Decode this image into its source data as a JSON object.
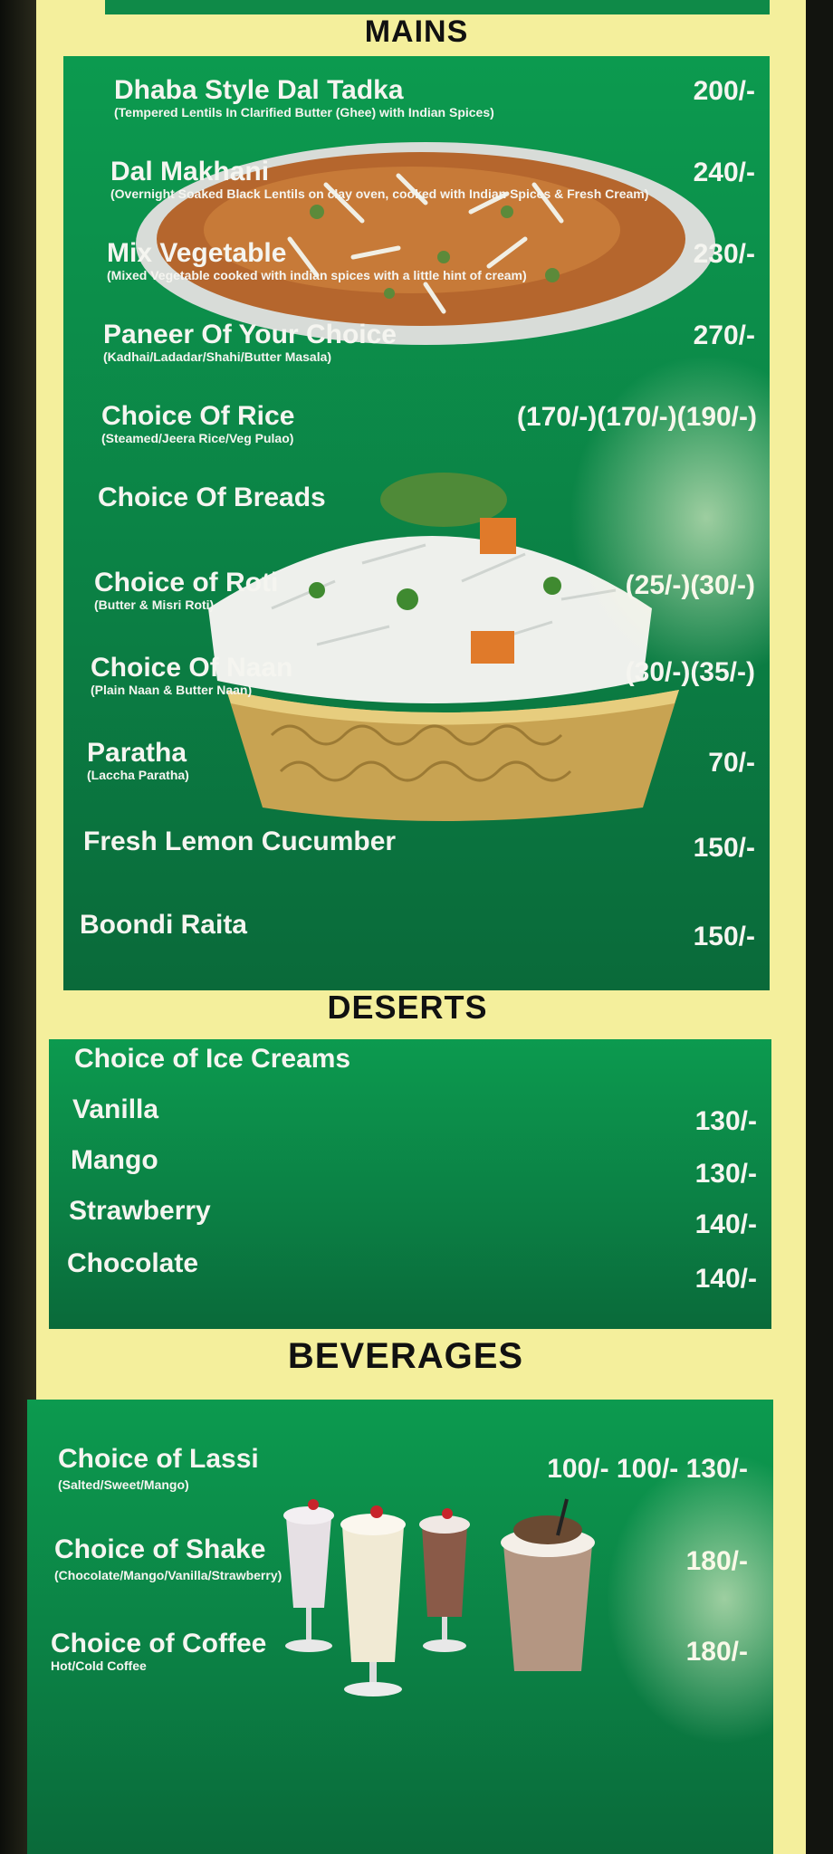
{
  "sections": {
    "mains": {
      "title": "MAINS",
      "items": [
        {
          "name": "Dhaba Style Dal Tadka",
          "desc": "(Tempered Lentils In Clarified Butter (Ghee) with Indian Spices)",
          "price": "200/-"
        },
        {
          "name": "Dal Makhani",
          "desc": "(Overnight Soaked Black Lentils on clay oven, cooked with Indian Spices & Fresh Cream)",
          "price": "240/-"
        },
        {
          "name": "Mix Vegetable",
          "desc": "(Mixed Vegetable cooked with indian spices with a little hint of cream)",
          "price": "230/-"
        },
        {
          "name": "Paneer Of Your Choice",
          "desc": "(Kadhai/Ladadar/Shahi/Butter Masala)",
          "price": "270/-"
        },
        {
          "name": "Choice Of Rice",
          "desc": "(Steamed/Jeera Rice/Veg Pulao)",
          "price": "(170/-)(170/-)(190/-)"
        },
        {
          "name": "Choice Of Breads",
          "desc": "",
          "price": ""
        },
        {
          "name": "Choice of Roti",
          "desc": "(Butter & Misri Roti)",
          "price": "(25/-)(30/-)"
        },
        {
          "name": "Choice Of Naan",
          "desc": "(Plain Naan & Butter Naan)",
          "price": "(30/-)(35/-)"
        },
        {
          "name": "Paratha",
          "desc": "(Laccha Paratha)",
          "price": "70/-"
        },
        {
          "name": "Fresh Lemon Cucumber",
          "desc": "",
          "price": "150/-"
        },
        {
          "name": "Boondi Raita",
          "desc": "",
          "price": "150/-"
        }
      ]
    },
    "deserts": {
      "title": "DESERTS",
      "header": "Choice of Ice Creams",
      "items": [
        {
          "name": "Vanilla",
          "price": "130/-"
        },
        {
          "name": "Mango",
          "price": "130/-"
        },
        {
          "name": "Strawberry",
          "price": "140/-"
        },
        {
          "name": "Chocolate",
          "price": "140/-"
        }
      ]
    },
    "beverages": {
      "title": "BEVERAGES",
      "items": [
        {
          "name": "Choice of Lassi",
          "desc": "(Salted/Sweet/Mango)",
          "price": "100/- 100/- 130/-"
        },
        {
          "name": "Choice of Shake",
          "desc": "(Chocolate/Mango/Vanilla/Strawberry)",
          "price": "180/-"
        },
        {
          "name": "Choice of Coffee",
          "desc": "Hot/Cold Coffee",
          "price": "180/-"
        }
      ]
    }
  },
  "colors": {
    "card": "#f4ef9c",
    "panel_green": "#0c9a4f",
    "text": "#f5f5f0",
    "heading": "#111111"
  },
  "images": [
    "dal-bowl-photo",
    "rice-bowl-photo",
    "milkshake-glasses-photo"
  ]
}
